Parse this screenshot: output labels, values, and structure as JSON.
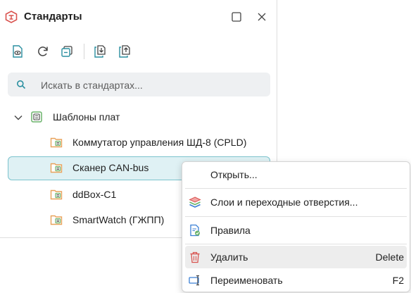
{
  "panel": {
    "title": "Стандарты"
  },
  "toolbar": {
    "buttons": [
      "view-standard-icon",
      "refresh-icon",
      "collapse-all-icon",
      "import-icon",
      "export-icon"
    ]
  },
  "search": {
    "placeholder": "Искать в стандартах..."
  },
  "tree": {
    "root": {
      "label": "Шаблоны плат",
      "expanded": true
    },
    "items": [
      {
        "label": "Коммутатор управления ШД-8 (CPLD)"
      },
      {
        "label": "Сканер CAN-bus",
        "selected": true
      },
      {
        "label": "ddBox-C1"
      },
      {
        "label": "SmartWatch (ГЖПП)"
      }
    ]
  },
  "context_menu": {
    "items": [
      {
        "label": "Открыть...",
        "icon": "none",
        "shortcut": ""
      },
      {
        "label": "Слои и переходные отверстия...",
        "icon": "layers-icon",
        "shortcut": ""
      },
      {
        "label": "Правила",
        "icon": "rules-icon",
        "shortcut": ""
      },
      {
        "label": "Удалить",
        "icon": "trash-icon",
        "shortcut": "Delete"
      },
      {
        "label": "Переименовать",
        "icon": "rename-icon",
        "shortcut": "F2"
      }
    ]
  },
  "colors": {
    "accent": "#2a8fa0",
    "selection_bg": "#dff1f4",
    "selection_border": "#7cc3cd",
    "brand_red": "#d9534f",
    "folder_orange": "#e8a25a",
    "board_green": "#6bb36b"
  }
}
